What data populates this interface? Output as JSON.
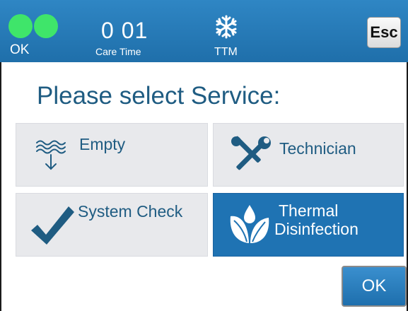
{
  "header": {
    "status_label": "OK",
    "timer_value": "0 01",
    "timer_label": "Care Time",
    "mode_label": "TTM",
    "esc_label": "Esc",
    "status_light_color": "#3fe56a",
    "bar_color": "#2478b8"
  },
  "title": "Please select Service:",
  "tiles": [
    {
      "label": "Empty",
      "icon": "empty-drain-icon",
      "selected": false
    },
    {
      "label": "Technician",
      "icon": "tools-icon",
      "selected": false
    },
    {
      "label": "System Check",
      "icon": "checkmark-icon",
      "selected": false
    },
    {
      "label_line1": "Thermal",
      "label_line2": "Disinfection",
      "icon": "leaves-drop-icon",
      "selected": true
    }
  ],
  "ok_label": "OK",
  "colors": {
    "accent_blue": "#1f73b3",
    "text_blue": "#1f5c82",
    "tile_bg": "#e8e9ec"
  }
}
